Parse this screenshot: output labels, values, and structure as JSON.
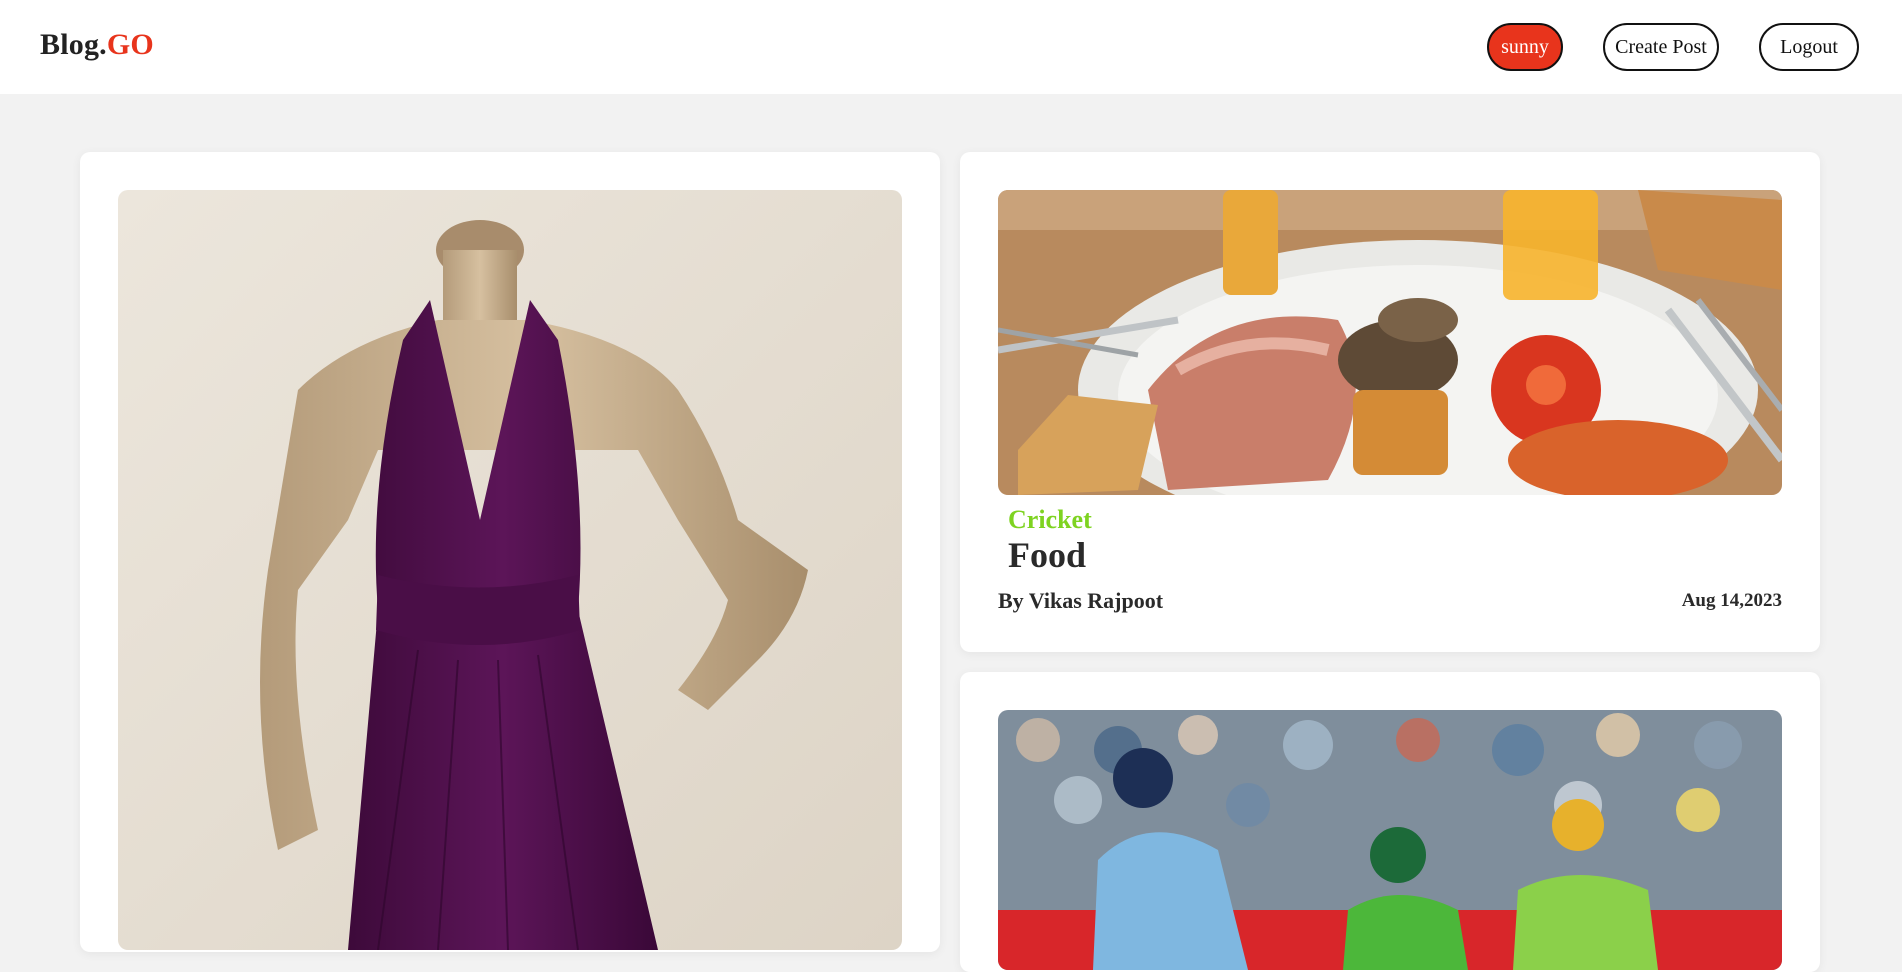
{
  "header": {
    "logo_text": "Blog.",
    "logo_accent": "GO",
    "user_label": "sunny",
    "create_post_label": "Create Post",
    "logout_label": "Logout"
  },
  "colors": {
    "accent": "#e8341c",
    "category": "#7ed321",
    "background": "#f2f2f2"
  },
  "posts": [
    {
      "image": "purple-halter-dress-on-mannequin"
    },
    {
      "image": "full-english-breakfast-plate",
      "category": "Cricket",
      "title": "Food",
      "author": "By Vikas Rajpoot",
      "date": "Aug 14,2023"
    },
    {
      "image": "cricket-batsman-and-fielders"
    }
  ]
}
